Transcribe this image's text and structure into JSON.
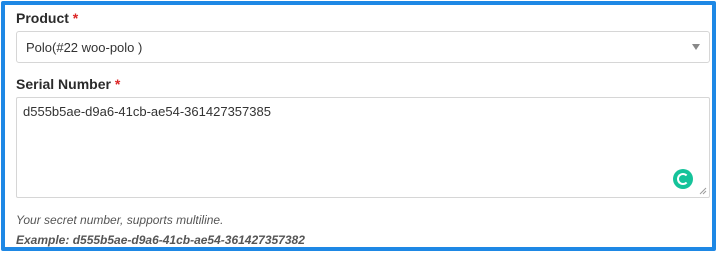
{
  "product": {
    "label": "Product",
    "required_mark": "*",
    "selected": "Polo(#22 woo-polo )"
  },
  "serial": {
    "label": "Serial Number",
    "required_mark": "*",
    "value": "d555b5ae-d9a6-41cb-ae54-361427357385",
    "help": "Your secret number, supports multiline.",
    "example": "Example: d555b5ae-d9a6-41cb-ae54-361427357382"
  },
  "colors": {
    "frame": "#1e88e5",
    "required": "#dc2626",
    "grammarly": "#15c39a"
  },
  "icons": {
    "select": "chevron-down-icon",
    "grammarly": "grammarly-icon",
    "resize": "resize-handle-icon"
  }
}
